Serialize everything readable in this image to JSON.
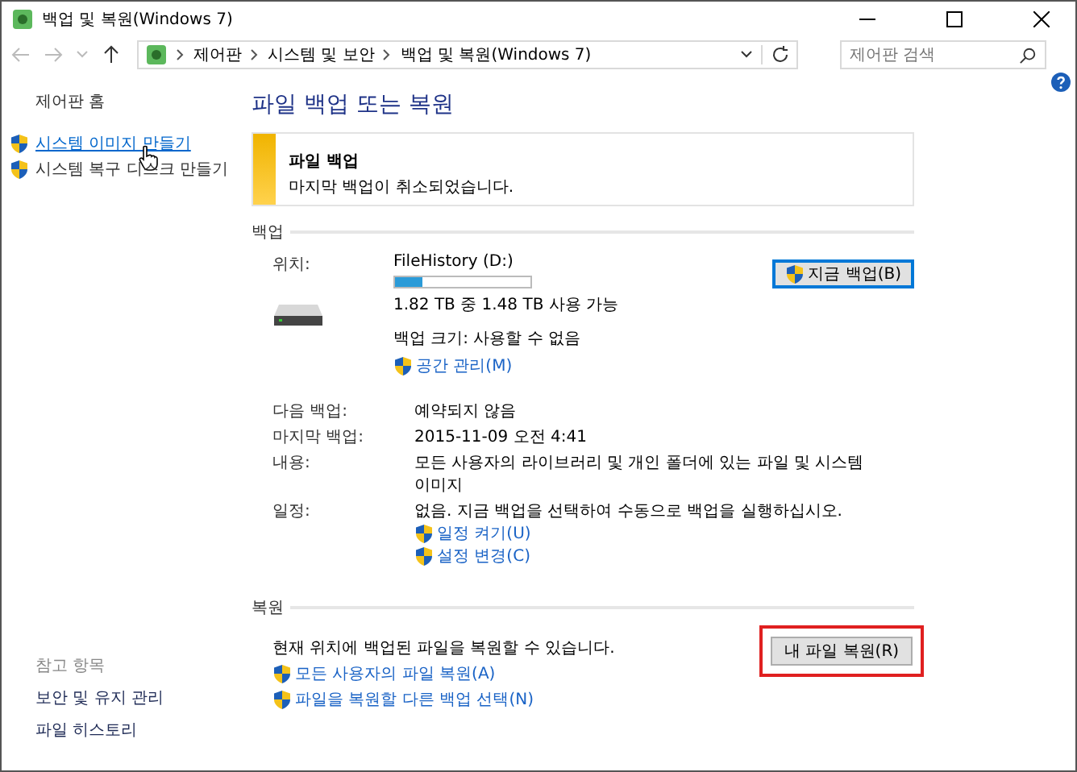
{
  "window": {
    "title": "백업 및 복원(Windows 7)"
  },
  "address_bar": {
    "path": [
      "제어판",
      "시스템 및 보안",
      "백업 및 복원(Windows 7)"
    ]
  },
  "search": {
    "placeholder": "제어판 검색"
  },
  "sidebar": {
    "home": "제어판 홈",
    "links": [
      {
        "label": "시스템 이미지 만들기",
        "hovered": true
      },
      {
        "label": "시스템 복구 디스크 만들기",
        "hovered": false
      }
    ],
    "see_also": {
      "heading": "참고 항목",
      "links": [
        "보안 및 유지 관리",
        "파일 히스토리"
      ]
    }
  },
  "main": {
    "title": "파일 백업 또는 복원",
    "notice": {
      "title": "파일 백업",
      "message": "마지막 백업이 취소되었습니다."
    },
    "backup": {
      "heading": "백업",
      "location_label": "위치:",
      "drive": "FileHistory (D:)",
      "level": 0.2,
      "space": "1.82 TB 중 1.48 TB 사용 가능",
      "size": "백업 크기: 사용할 수 없음",
      "manage_link": "공간 관리(M)",
      "button": {
        "label": "지금 백업(B)",
        "focused": true
      },
      "details": [
        {
          "label": "다음 백업:",
          "value": "예약되지 않음"
        },
        {
          "label": "마지막 백업:",
          "value": "2015-11-09 오전 4:41"
        },
        {
          "label": "내용:",
          "value": "모든 사용자의 라이브러리 및 개인 폴더에 있는 파일 및 시스템 이미지"
        },
        {
          "label": "일정:",
          "value": "없음. 지금 백업을 선택하여 수동으로 백업을 실행하십시오.",
          "links": [
            "일정 켜기(U)",
            "설정 변경(C)"
          ]
        }
      ]
    },
    "restore": {
      "heading": "복원",
      "message": "현재 위치에 백업된 파일을 복원할 수 있습니다.",
      "links": [
        "모든 사용자의 파일 복원(A)",
        "파일을 복원할 다른 백업 선택(N)"
      ],
      "button": {
        "label": "내 파일 복원(R)",
        "highlighted": true
      }
    }
  }
}
